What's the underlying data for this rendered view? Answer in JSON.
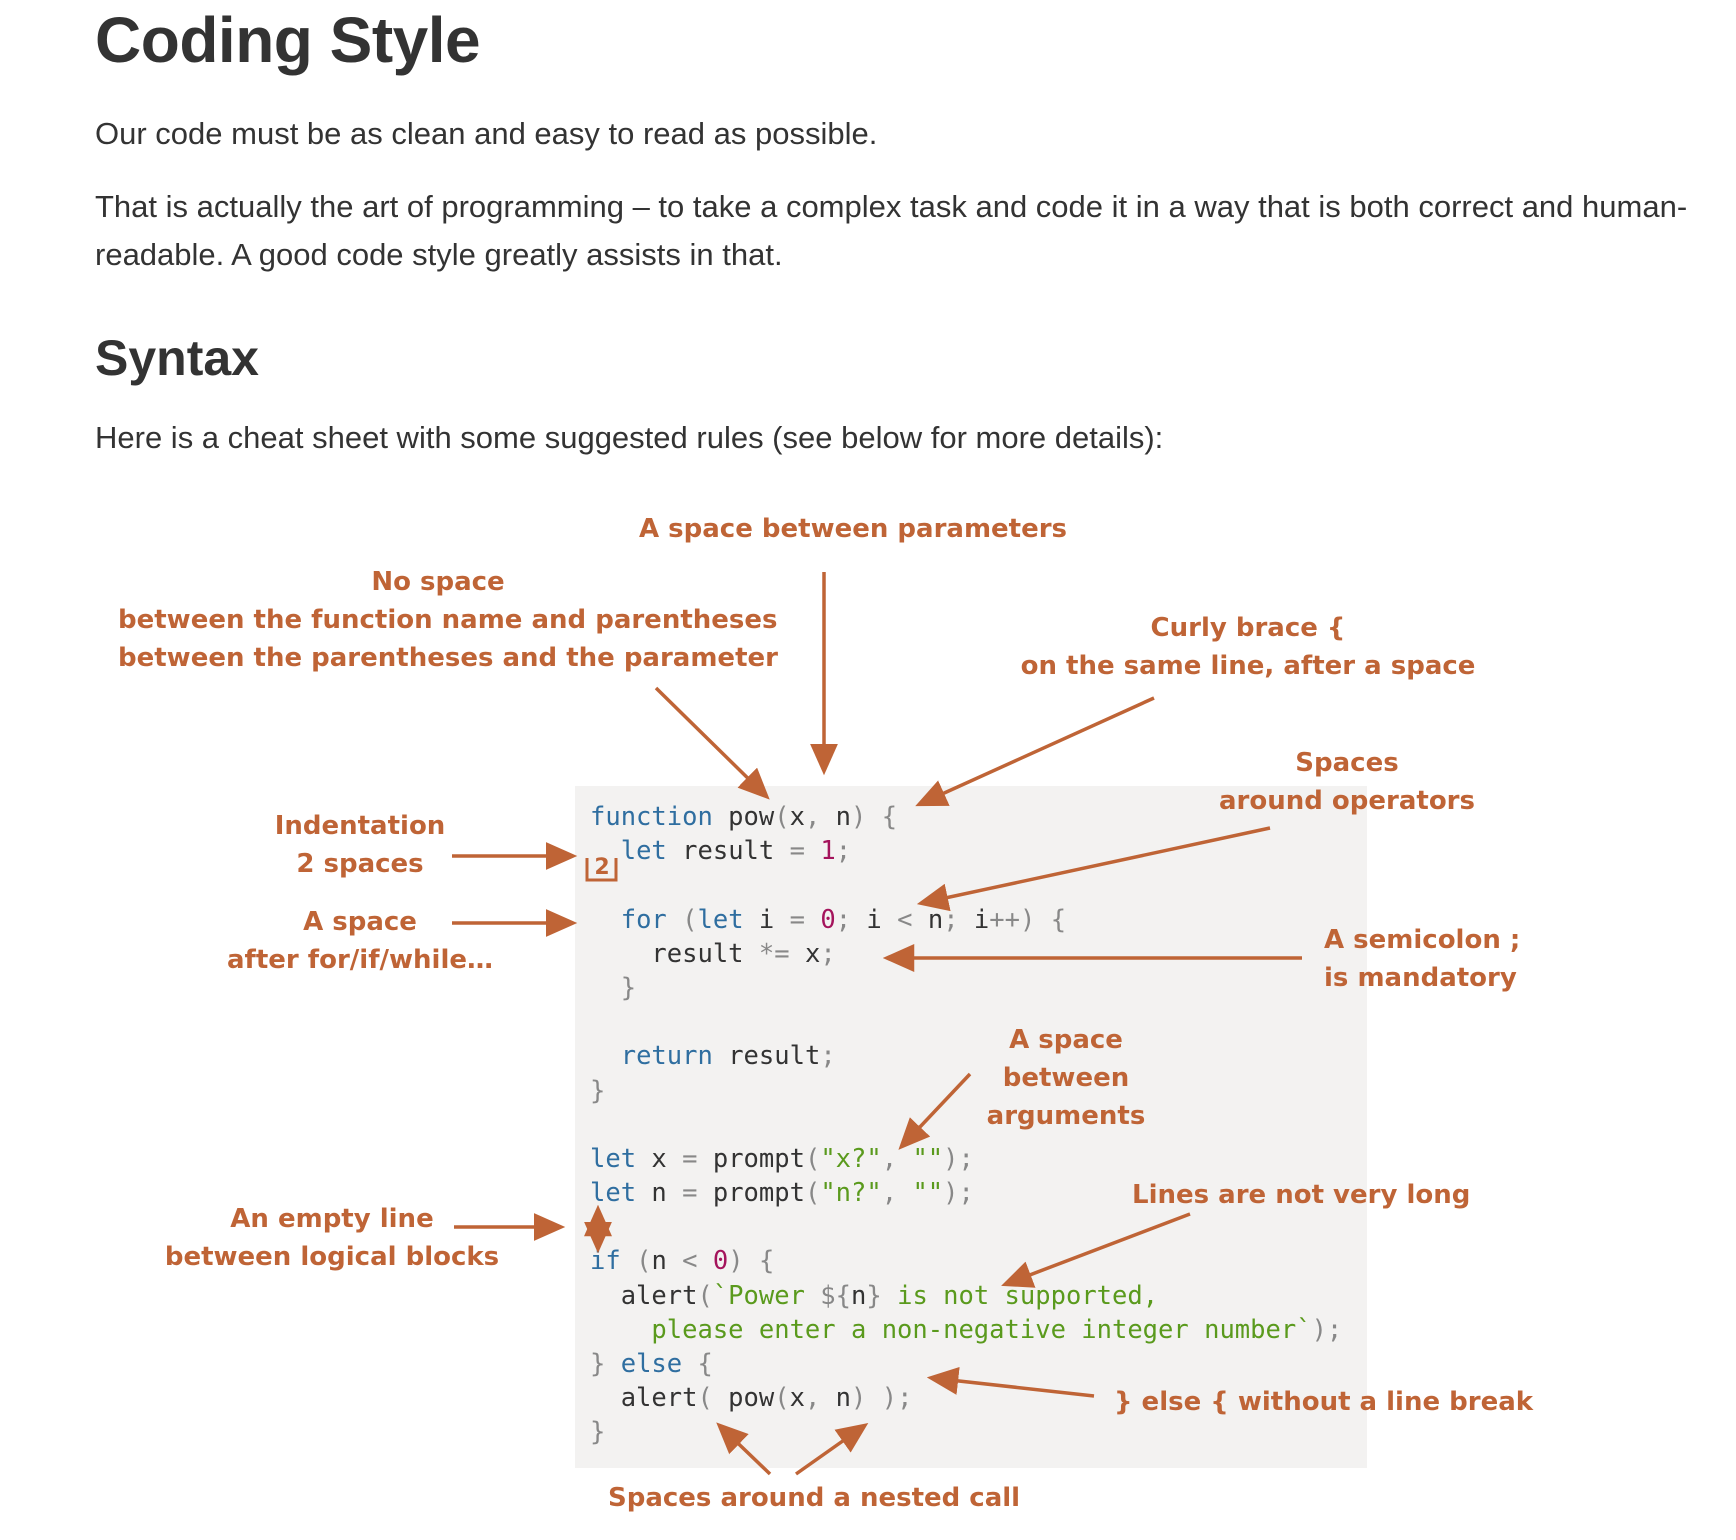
{
  "article": {
    "title": "Coding Style",
    "intro": "Our code must be as clean and easy to read as possible.",
    "paragraph2": "That is actually the art of programming – to take a complex task and code it in a way that is both correct and human-readable. A good code style greatly assists in that.",
    "section_title": "Syntax",
    "cheat_sheet_intro": "Here is a cheat sheet with some suggested rules (see below for more details):"
  },
  "annotations": {
    "space_between_params": "A space between parameters",
    "no_space_1": "No space",
    "no_space_2": "between the function name and parentheses",
    "no_space_3": "between the parentheses and the parameter",
    "curly_1": "Curly brace {",
    "curly_2": "on the same line, after a space",
    "spaces_ops_1": "Spaces",
    "spaces_ops_2": "around operators",
    "indent_1": "Indentation",
    "indent_2": "2 spaces",
    "indent_badge": "2",
    "space_after_1": "A space",
    "space_after_2": "after for/if/while…",
    "semicolon_1": "A semicolon ;",
    "semicolon_2": "is mandatory",
    "space_args_1": "A space",
    "space_args_2": "between",
    "space_args_3": "arguments",
    "lines_long": "Lines are not very long",
    "empty_line_1": "An empty line",
    "empty_line_2": "between logical blocks",
    "else_brace": "} else { without a line break",
    "nested_call": "Spaces around a nested call"
  },
  "colors": {
    "annotation": "#bf6436",
    "keyword": "#2f6ea0",
    "number": "#a4145c",
    "string": "#5a9a1d",
    "punctuation": "#888888",
    "code_background": "#f3f2f1",
    "text": "#333333"
  },
  "code_lines": [
    "function pow(x, n) {",
    "  let result = 1;",
    "",
    "  for (let i = 0; i < n; i++) {",
    "    result *= x;",
    "  }",
    "",
    "  return result;",
    "}",
    "",
    "let x = prompt(\"x?\", \"\");",
    "let n = prompt(\"n?\", \"\");",
    "",
    "if (n < 0) {",
    "  alert(`Power ${n} is not supported,",
    "    please enter a non-negative integer number`);",
    "} else {",
    "  alert( pow(x, n) );",
    "}"
  ]
}
